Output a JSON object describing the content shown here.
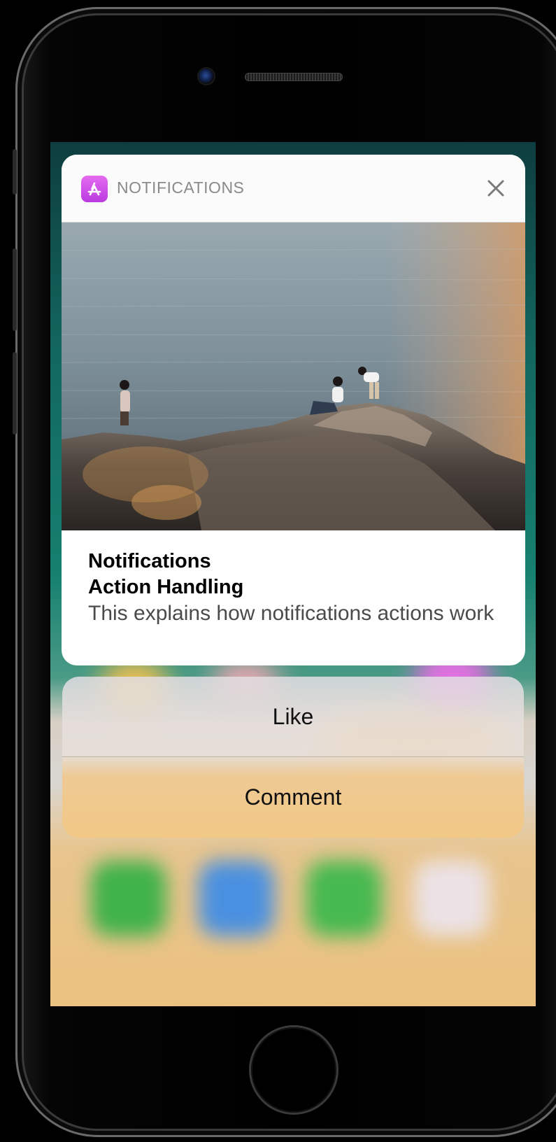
{
  "notification": {
    "app_name": "NOTIFICATIONS",
    "app_icon": "app-store-icon",
    "close_icon": "close-icon",
    "title_line1": "Notifications",
    "title_line2": "Action Handling",
    "body": "This explains how notifications actions work"
  },
  "actions": [
    {
      "label": "Like"
    },
    {
      "label": "Comment"
    }
  ],
  "colors": {
    "app_icon_gradient_top": "#e56cf0",
    "app_icon_gradient_bottom": "#b93be0",
    "card_background": "#ffffff",
    "app_name_text": "#8a8a8a",
    "body_text": "#4a4a4a"
  }
}
